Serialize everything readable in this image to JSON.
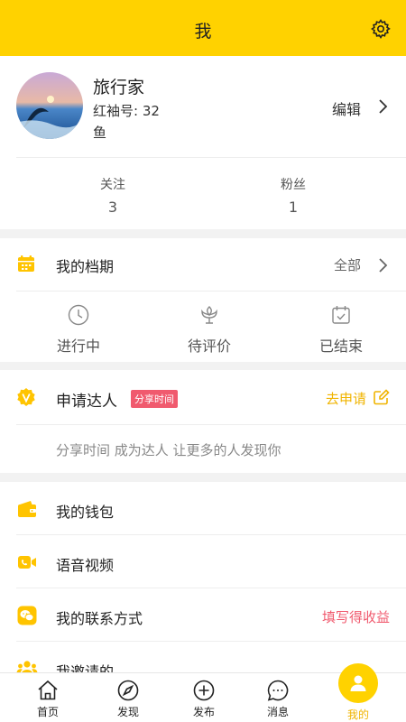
{
  "header": {
    "title": "我"
  },
  "profile": {
    "name": "旅行家",
    "id_line": "红袖号: 32",
    "extra_line": "鱼",
    "edit_label": "编辑",
    "stats": [
      {
        "label": "关注",
        "value": "3"
      },
      {
        "label": "粉丝",
        "value": "1"
      }
    ]
  },
  "schedule": {
    "title": "我的档期",
    "all_label": "全部",
    "items": [
      {
        "label": "进行中",
        "icon": "clock-icon"
      },
      {
        "label": "待评价",
        "icon": "flower-icon"
      },
      {
        "label": "已结束",
        "icon": "calendar-check-icon"
      }
    ]
  },
  "expert": {
    "title": "申请达人",
    "tag": "分享时间",
    "apply_label": "去申请",
    "description": "分享时间 成为达人 让更多的人发现你"
  },
  "menu": [
    {
      "label": "我的钱包",
      "icon": "wallet-icon",
      "right": ""
    },
    {
      "label": "语音视频",
      "icon": "video-call-icon",
      "right": ""
    },
    {
      "label": "我的联系方式",
      "icon": "chat-contact-icon",
      "right": "填写得收益"
    },
    {
      "label": "我邀请的",
      "icon": "people-icon",
      "right": ""
    }
  ],
  "tabbar": {
    "home": "首页",
    "discover": "发现",
    "publish": "发布",
    "messages": "消息",
    "mine": "我的"
  },
  "colors": {
    "accent": "#ffd200",
    "accent_text": "#f0b400",
    "highlight_red": "#f05a6e"
  }
}
